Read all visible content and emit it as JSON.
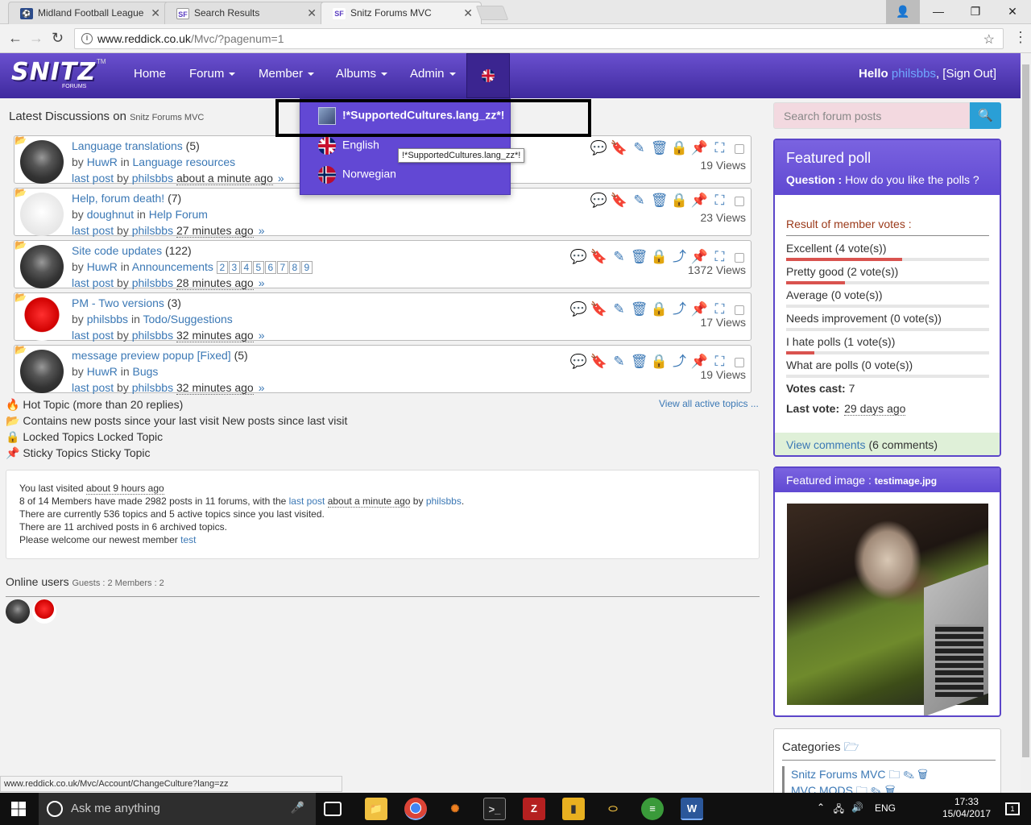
{
  "browser": {
    "tabs": [
      {
        "title": "Midland Football League",
        "icon": "football-league-favicon"
      },
      {
        "title": "Search Results",
        "icon": "snitz-favicon"
      },
      {
        "title": "Snitz Forums MVC",
        "icon": "snitz-favicon"
      }
    ],
    "url_host": "www.reddick.co.uk",
    "url_path": "/Mvc/?pagenum=1",
    "status_url": "www.reddick.co.uk/Mvc/Account/ChangeCulture?lang=zz"
  },
  "navbar": {
    "logo": "SNITZ",
    "logo_sub": "FORUMS",
    "logo_tm": "TM",
    "items": [
      "Home",
      "Forum",
      "Member",
      "Albums",
      "Admin"
    ],
    "hello": "Hello",
    "username": "philsbbs",
    "signout": ", [Sign Out]"
  },
  "language_menu": {
    "items": [
      "!*SupportedCultures.lang_zz*!",
      "English",
      "Norwegian"
    ],
    "tooltip": "!*SupportedCultures.lang_zz*!"
  },
  "latest": {
    "title": "Latest Discussions on",
    "site": "Snitz Forums MVC",
    "topics": [
      {
        "title": "Language translations",
        "count": "(5)",
        "by": "by",
        "author": "HuwR",
        "in": "in",
        "forum": "Language resources",
        "pages": [],
        "lastpost": "last post",
        "lp_by": "by",
        "lp_user": "philsbbs",
        "lp_time": "about a minute ago",
        "views": "19 Views",
        "avatar": "dalek",
        "share": false
      },
      {
        "title": "Help, forum death!",
        "count": "(7)",
        "by": "by",
        "author": "doughnut",
        "in": "in",
        "forum": "Help Forum",
        "pages": [],
        "lastpost": "last post",
        "lp_by": "by",
        "lp_user": "philsbbs",
        "lp_time": "27 minutes ago",
        "views": "23 Views",
        "avatar": "ghost",
        "share": false
      },
      {
        "title": "Site code updates",
        "count": "(122)",
        "by": "by",
        "author": "HuwR",
        "in": "in",
        "forum": "Announcements",
        "pages": [
          "2",
          "3",
          "4",
          "5",
          "6",
          "7",
          "8",
          "9"
        ],
        "lastpost": "last post",
        "lp_by": "by",
        "lp_user": "philsbbs",
        "lp_time": "28 minutes ago",
        "views": "1372 Views",
        "avatar": "dalek",
        "share": true
      },
      {
        "title": "PM - Two versions",
        "count": "(3)",
        "by": "by",
        "author": "philsbbs",
        "in": "in",
        "forum": "Todo/Suggestions",
        "pages": [],
        "lastpost": "last post",
        "lp_by": "by",
        "lp_user": "philsbbs",
        "lp_time": "32 minutes ago",
        "views": "17 Views",
        "avatar": "red",
        "share": true
      },
      {
        "title": "message preview popup [Fixed]",
        "count": "(5)",
        "by": "by",
        "author": "HuwR",
        "in": "in",
        "forum": "Bugs",
        "pages": [],
        "lastpost": "last post",
        "lp_by": "by",
        "lp_user": "philsbbs",
        "lp_time": "32 minutes ago",
        "views": "19 Views",
        "avatar": "dalek",
        "share": true
      }
    ],
    "view_all": "View all active topics ..."
  },
  "legend": [
    {
      "icon": "fire-icon",
      "text": "Hot Topic (more than 20 replies)"
    },
    {
      "icon": "new-folder-icon",
      "text": "Contains new posts since your last visit New posts since last visit"
    },
    {
      "icon": "lock-icon",
      "text": "Locked Topics Locked Topic"
    },
    {
      "icon": "pin-icon",
      "text": "Sticky Topics Sticky Topic"
    }
  ],
  "stats": {
    "line1_a": "You last visited",
    "line1_b": "about 9 hours ago",
    "line2_a": "8 of 14 Members have made 2982 posts in 11 forums, with the",
    "line2_link": "last post",
    "line2_b": "about a minute ago",
    "line2_c": "by",
    "line2_user": "philsbbs",
    "line3": "There are currently 536 topics and 5 active topics since you last visited.",
    "line4": "There are 11 archived posts in 6 archived topics.",
    "line5_a": "Please welcome our newest member",
    "line5_user": "test"
  },
  "online": {
    "title": "Online users",
    "counts": "Guests : 2 Members : 2"
  },
  "search": {
    "placeholder": "Search forum posts"
  },
  "poll": {
    "title": "Featured poll",
    "question_label": "Question :",
    "question": "How do you like the polls ?",
    "result_label": "Result of member votes :",
    "options": [
      {
        "text": "Excellent (4 vote(s))",
        "fraction": 0.57
      },
      {
        "text": "Pretty good (2 vote(s))",
        "fraction": 0.29
      },
      {
        "text": "Average (0 vote(s))",
        "fraction": 0
      },
      {
        "text": "Needs improvement (0 vote(s))",
        "fraction": 0
      },
      {
        "text": "I hate polls (1 vote(s))",
        "fraction": 0.14
      },
      {
        "text": "What are polls (0 vote(s))",
        "fraction": 0
      }
    ],
    "votes_label": "Votes cast:",
    "votes": "7",
    "last_label": "Last vote:",
    "last": "29 days ago",
    "comments_link": "View comments",
    "comments_count": "(6 comments)"
  },
  "featured_image": {
    "label": "Featured image :",
    "filename": "testimage.jpg"
  },
  "categories": {
    "title": "Categories",
    "items": [
      "Snitz Forums MVC",
      "MVC MODS"
    ]
  },
  "taskbar": {
    "search": "Ask me anything",
    "lang": "ENG",
    "time": "17:33",
    "date": "15/04/2017",
    "notifications": "1"
  },
  "colors": {
    "accent": "#6049d2",
    "link": "#3b78b5",
    "bar": "#d9534f"
  }
}
